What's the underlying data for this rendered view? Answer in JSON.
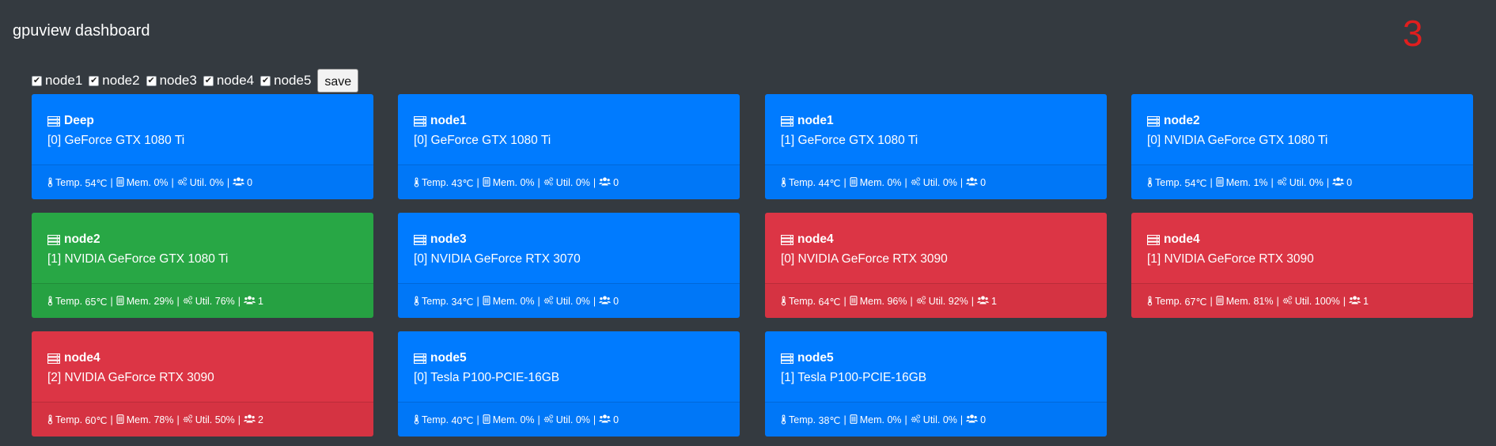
{
  "header": {
    "title": "gpuview dashboard",
    "counter": "3"
  },
  "filters": {
    "nodes": [
      {
        "label": "node1",
        "checked": true
      },
      {
        "label": "node2",
        "checked": true
      },
      {
        "label": "node3",
        "checked": true
      },
      {
        "label": "node4",
        "checked": true
      },
      {
        "label": "node5",
        "checked": true
      }
    ],
    "save_label": "save"
  },
  "stat_labels": {
    "temp": "Temp.",
    "mem": "Mem.",
    "util": "Util."
  },
  "colors": {
    "background": "#343a40",
    "primary": "#007bff",
    "success": "#28a745",
    "danger": "#dc3545",
    "counter": "#e01e1e"
  },
  "cards": [
    {
      "host": "Deep",
      "gpu": "[0] GeForce GTX 1080 Ti",
      "temp": "54℃",
      "mem": "0%",
      "util": "0%",
      "users": "0",
      "status": "primary"
    },
    {
      "host": "node1",
      "gpu": "[0] GeForce GTX 1080 Ti",
      "temp": "43℃",
      "mem": "0%",
      "util": "0%",
      "users": "0",
      "status": "primary"
    },
    {
      "host": "node1",
      "gpu": "[1] GeForce GTX 1080 Ti",
      "temp": "44℃",
      "mem": "0%",
      "util": "0%",
      "users": "0",
      "status": "primary"
    },
    {
      "host": "node2",
      "gpu": "[0] NVIDIA GeForce GTX 1080 Ti",
      "temp": "54℃",
      "mem": "1%",
      "util": "0%",
      "users": "0",
      "status": "primary"
    },
    {
      "host": "node2",
      "gpu": "[1] NVIDIA GeForce GTX 1080 Ti",
      "temp": "65℃",
      "mem": "29%",
      "util": "76%",
      "users": "1",
      "status": "success"
    },
    {
      "host": "node3",
      "gpu": "[0] NVIDIA GeForce RTX 3070",
      "temp": "34℃",
      "mem": "0%",
      "util": "0%",
      "users": "0",
      "status": "primary"
    },
    {
      "host": "node4",
      "gpu": "[0] NVIDIA GeForce RTX 3090",
      "temp": "64℃",
      "mem": "96%",
      "util": "92%",
      "users": "1",
      "status": "danger"
    },
    {
      "host": "node4",
      "gpu": "[1] NVIDIA GeForce RTX 3090",
      "temp": "67℃",
      "mem": "81%",
      "util": "100%",
      "users": "1",
      "status": "danger"
    },
    {
      "host": "node4",
      "gpu": "[2] NVIDIA GeForce RTX 3090",
      "temp": "60℃",
      "mem": "78%",
      "util": "50%",
      "users": "2",
      "status": "danger"
    },
    {
      "host": "node5",
      "gpu": "[0] Tesla P100-PCIE-16GB",
      "temp": "40℃",
      "mem": "0%",
      "util": "0%",
      "users": "0",
      "status": "primary"
    },
    {
      "host": "node5",
      "gpu": "[1] Tesla P100-PCIE-16GB",
      "temp": "38℃",
      "mem": "0%",
      "util": "0%",
      "users": "0",
      "status": "primary"
    }
  ]
}
